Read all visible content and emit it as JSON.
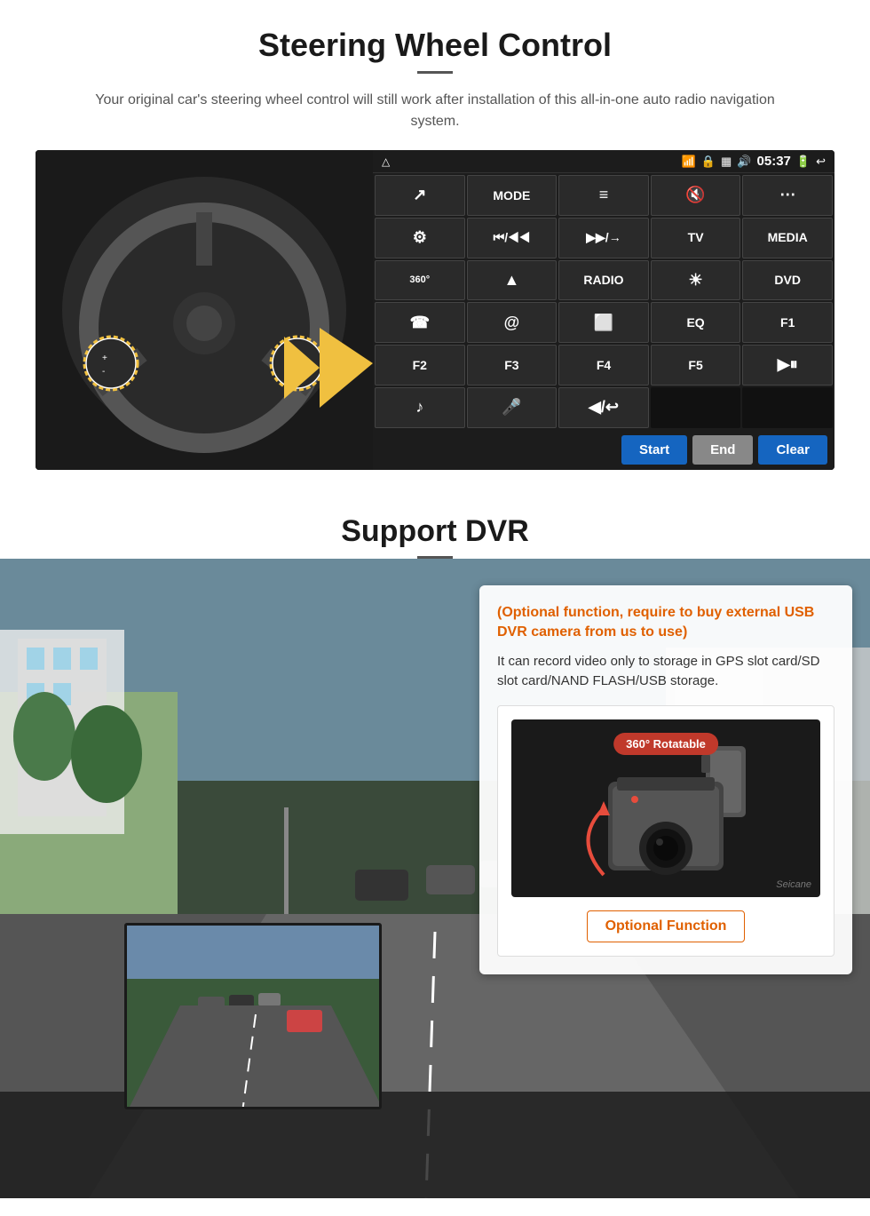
{
  "page": {
    "section1": {
      "title": "Steering Wheel Control",
      "description": "Your original car's steering wheel control will still work after installation of this all-in-one auto radio navigation system.",
      "ui_panel": {
        "time": "05:37",
        "top_bar_icons": [
          "home",
          "wifi",
          "lock",
          "sim",
          "battery"
        ],
        "buttons": [
          {
            "label": "↗",
            "type": "icon"
          },
          {
            "label": "MODE",
            "type": "text"
          },
          {
            "label": "≡",
            "type": "icon"
          },
          {
            "label": "🔇×",
            "type": "icon"
          },
          {
            "label": "⋯",
            "type": "icon"
          },
          {
            "label": "⊙",
            "type": "icon"
          },
          {
            "label": "⏮/◀◀",
            "type": "text"
          },
          {
            "label": "▶▶/→",
            "type": "text"
          },
          {
            "label": "TV",
            "type": "text"
          },
          {
            "label": "MEDIA",
            "type": "text"
          },
          {
            "label": "360°",
            "type": "text"
          },
          {
            "label": "▲",
            "type": "text"
          },
          {
            "label": "RADIO",
            "type": "text"
          },
          {
            "label": "☀",
            "type": "icon"
          },
          {
            "label": "DVD",
            "type": "text"
          },
          {
            "label": "☎",
            "type": "icon"
          },
          {
            "label": "@",
            "type": "icon"
          },
          {
            "label": "⊟",
            "type": "icon"
          },
          {
            "label": "EQ",
            "type": "text"
          },
          {
            "label": "F1",
            "type": "text"
          },
          {
            "label": "F2",
            "type": "text"
          },
          {
            "label": "F3",
            "type": "text"
          },
          {
            "label": "F4",
            "type": "text"
          },
          {
            "label": "F5",
            "type": "text"
          },
          {
            "label": "▶⏸",
            "type": "icon"
          },
          {
            "label": "♪",
            "type": "icon"
          },
          {
            "label": "🎤",
            "type": "icon"
          },
          {
            "label": "◀/↩",
            "type": "icon"
          },
          {
            "label": "",
            "type": "empty"
          },
          {
            "label": "",
            "type": "empty"
          }
        ],
        "bottom_buttons": [
          {
            "label": "Start",
            "type": "start"
          },
          {
            "label": "End",
            "type": "end"
          },
          {
            "label": "Clear",
            "type": "clear"
          }
        ]
      }
    },
    "section2": {
      "title": "Support DVR",
      "optional_text": "(Optional function, require to buy external USB DVR camera from us to use)",
      "description": "It can record video only to storage in GPS slot card/SD slot card/NAND FLASH/USB storage.",
      "camera_badge": "360° Rotatable",
      "watermark": "Seicane",
      "optional_function_label": "Optional Function"
    }
  }
}
